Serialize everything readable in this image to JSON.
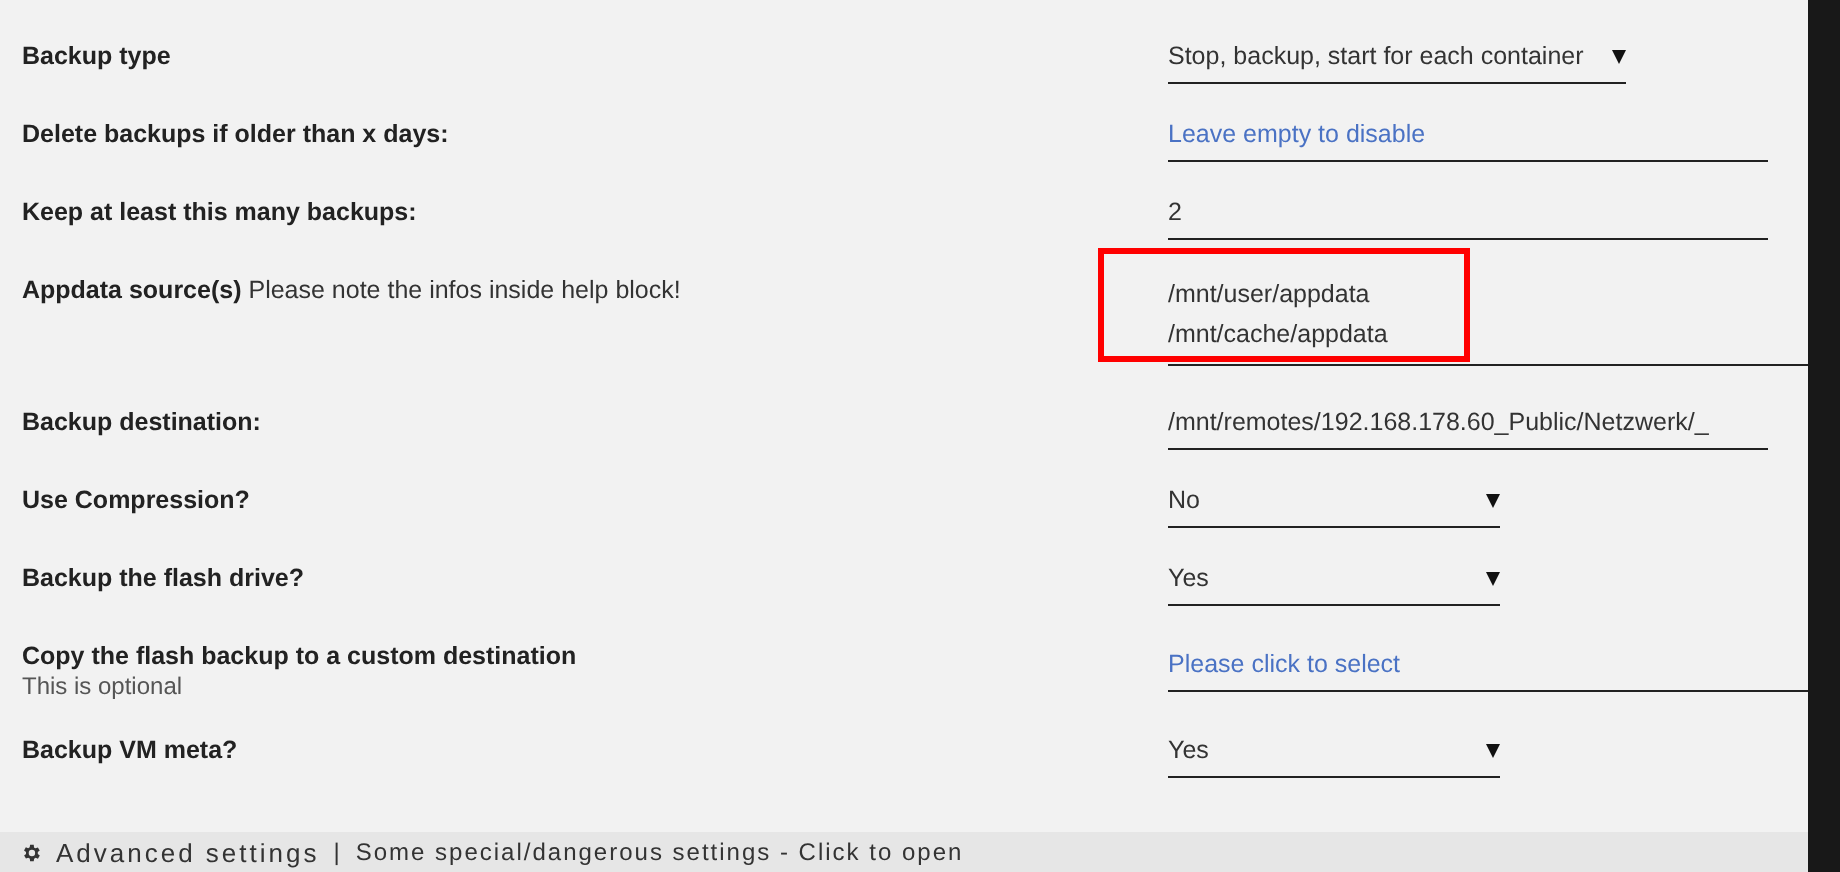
{
  "settings": [
    {
      "label": "Backup type",
      "kind": "wideselect",
      "value": "Stop, backup, start for each container"
    },
    {
      "label": "Delete backups if older than x days:",
      "kind": "input",
      "placeholder": "Leave empty to disable"
    },
    {
      "label": "Keep at least this many backups:",
      "kind": "input",
      "value": "2"
    },
    {
      "label": "Appdata source(s)",
      "note": "Please note the infos inside help block!",
      "kind": "multiline",
      "lines": [
        "/mnt/user/appdata",
        "/mnt/cache/appdata"
      ],
      "highlighted": true
    },
    {
      "label": "Backup destination:",
      "kind": "input",
      "value": "/mnt/remotes/192.168.178.60_Public/Netzwerk/_"
    },
    {
      "label": "Use Compression?",
      "kind": "select",
      "value": "No"
    },
    {
      "label": "Backup the flash drive?",
      "kind": "select",
      "value": "Yes"
    },
    {
      "label": "Copy the flash backup to a custom destination",
      "sublabel": "This is optional",
      "kind": "picker",
      "placeholder": "Please click to select"
    },
    {
      "label": "Backup VM meta?",
      "kind": "select",
      "value": "Yes"
    }
  ],
  "advanced": {
    "title": "Advanced settings",
    "separator": "|",
    "hint": "Some special/dangerous settings - Click to open"
  }
}
